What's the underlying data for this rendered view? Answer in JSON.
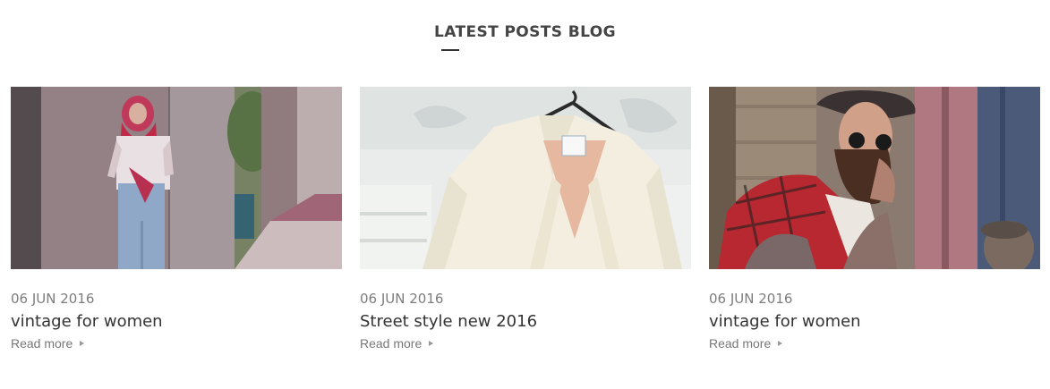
{
  "section": {
    "title": "LATEST POSTS BLOG"
  },
  "posts": [
    {
      "date": "06 JUN 2016",
      "title": "vintage for women",
      "read_more": "Read more",
      "image": "woman-red-headscarf-photo"
    },
    {
      "date": "06 JUN 2016",
      "title": "Street style new 2016",
      "read_more": "Read more",
      "image": "cream-shirt-on-hanger-photo"
    },
    {
      "date": "06 JUN 2016",
      "title": "vintage for women",
      "read_more": "Read more",
      "image": "bearded-man-plaid-shirt-photo"
    }
  ],
  "icons": {
    "read_more_arrow": "triangle-right-icon"
  }
}
